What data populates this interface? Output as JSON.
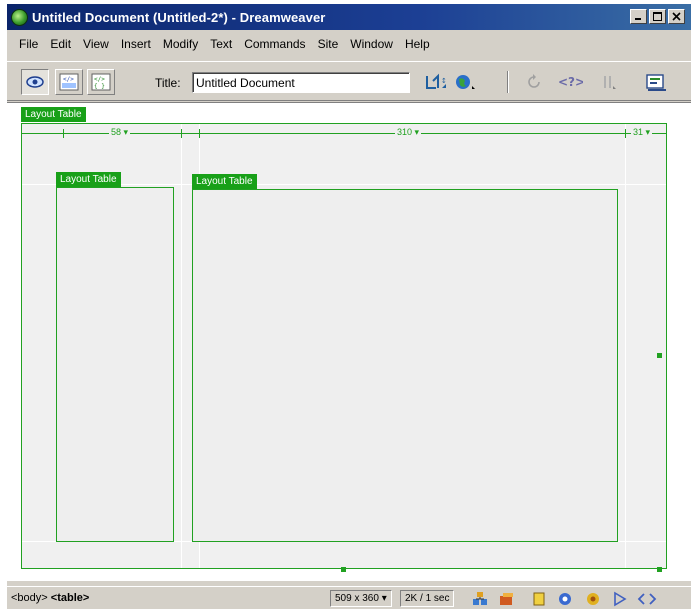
{
  "window": {
    "title": "Untitled Document (Untitled-2*) - Dreamweaver",
    "app_icon": "dreamweaver-logo-icon",
    "controls": [
      "minimize-icon",
      "maximize-icon",
      "close-icon"
    ]
  },
  "menubar": {
    "items": [
      "File",
      "Edit",
      "View",
      "Insert",
      "Modify",
      "Text",
      "Commands",
      "Site",
      "Window",
      "Help"
    ]
  },
  "toolbar": {
    "view_buttons": [
      "design-view-icon",
      "code-and-design-view-icon",
      "code-view-icon"
    ],
    "title_label": "Title:",
    "title_value": "Untitled Document",
    "tools": [
      "file-management-icon",
      "preview-in-browser-icon",
      "refresh-icon",
      "code-navigation-icon",
      "view-options-icon",
      "reference-icon"
    ]
  },
  "document": {
    "outer_tag": "Layout Table",
    "ruler_labels": [
      "58 ▾",
      "310 ▾",
      "31 ▾"
    ],
    "inner_tags": [
      "Layout Table",
      "Layout Table"
    ]
  },
  "statusbar": {
    "tag_body": "<body>",
    "tag_table": "<table>",
    "window_size": "509 x 360 ▾",
    "download_stats": "2K / 1 sec",
    "launcher_icons": [
      "site-icon",
      "assets-icon",
      "html-styles-icon",
      "css-styles-icon",
      "behaviors-icon",
      "history-icon",
      "code-inspector-icon"
    ]
  },
  "colors": {
    "titlebar": "#0a246a",
    "layout_green": "#18a018",
    "chrome": "#d4d0c8"
  }
}
